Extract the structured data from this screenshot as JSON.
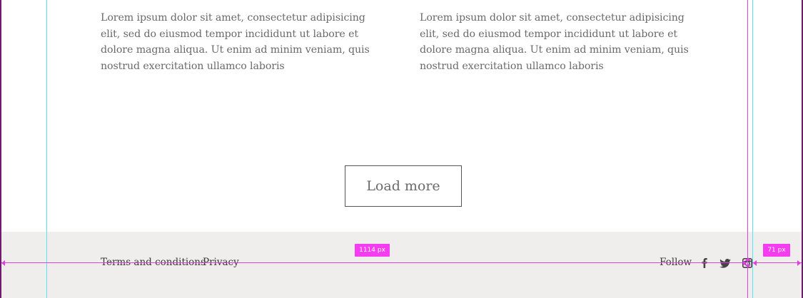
{
  "content": {
    "paragraph_left": "Lorem ipsum dolor sit amet, consectetur adipisicing elit, sed do eiusmod tempor incididunt ut labore et dolore magna aliqua. Ut enim ad minim veniam, quis nostrud exercitation ullamco laboris",
    "paragraph_right": "Lorem ipsum dolor sit amet, consectetur adipisicing elit, sed do eiusmod tempor incididunt ut labore et dolore magna aliqua. Ut enim ad minim veniam, quis nostrud exercitation ullamco laboris",
    "load_more_label": "Load more"
  },
  "footer": {
    "links": [
      {
        "label": "Terms and conditions"
      },
      {
        "label": "Privacy"
      }
    ],
    "follow_label": "Follow",
    "social": [
      {
        "icon": "facebook-icon"
      },
      {
        "icon": "twitter-icon"
      },
      {
        "icon": "instagram-icon"
      }
    ]
  },
  "measurements": {
    "width_badge": "1114 px",
    "margin_badge": "71 px"
  },
  "colors": {
    "footer_bg": "#f0eeed",
    "guide": "#5ce1f0",
    "measure": "#f53cf0",
    "frame": "#6f1b6f"
  }
}
